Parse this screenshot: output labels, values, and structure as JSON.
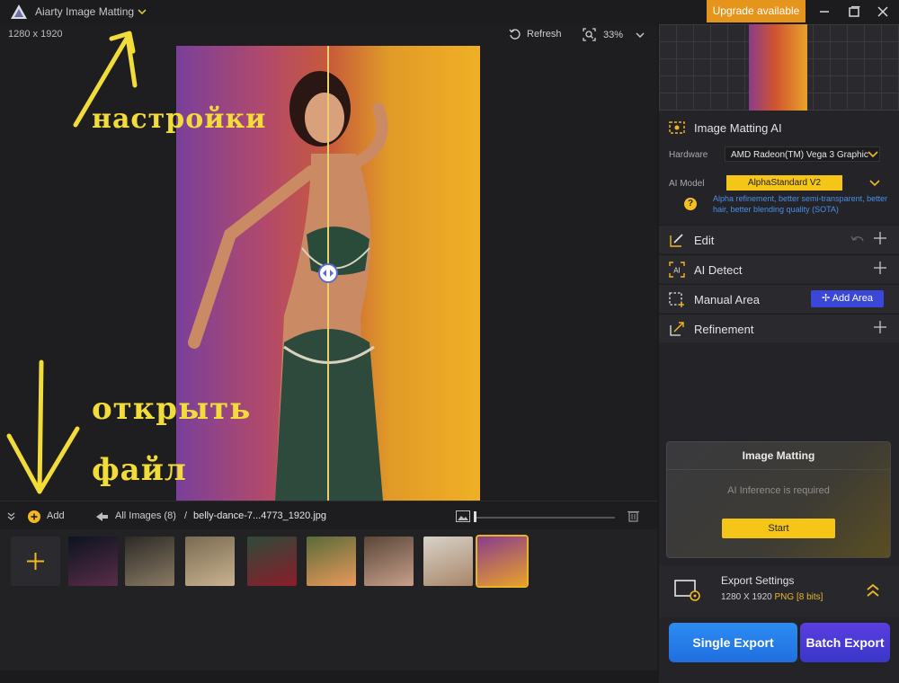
{
  "titlebar": {
    "app_title": "Aiarty Image Matting",
    "upgrade_label": "Upgrade available"
  },
  "canvas": {
    "dimensions": "1280 x 1920",
    "refresh_label": "Refresh",
    "zoom_level": "33%"
  },
  "annotations": {
    "settings_note": "настройки",
    "open_note_line1": "открыть",
    "open_note_line2": "файл"
  },
  "strip": {
    "add_label": "Add",
    "breadcrumb_all": "All Images (8)",
    "breadcrumb_sep": "/",
    "breadcrumb_file": "belly-dance-7...4773_1920.jpg",
    "thumbnails": [
      {
        "name": "jellyfish",
        "colors": [
          "#0b1420",
          "#5a2c48"
        ]
      },
      {
        "name": "forest-creature",
        "colors": [
          "#2c2a26",
          "#8a7a64"
        ]
      },
      {
        "name": "bicycle",
        "colors": [
          "#7a6a52",
          "#c8b390"
        ]
      },
      {
        "name": "woman-red-dress-forest",
        "colors": [
          "#2e4a3a",
          "#8b1d2a"
        ]
      },
      {
        "name": "woman-flowers",
        "colors": [
          "#5a6a3a",
          "#e89a5a"
        ]
      },
      {
        "name": "woman-portrait",
        "colors": [
          "#5a4638",
          "#c8a08a"
        ]
      },
      {
        "name": "woman-white-flowers",
        "colors": [
          "#d8d2c8",
          "#a8866a"
        ]
      },
      {
        "name": "belly-dancer",
        "colors": [
          "#8a3c8c",
          "#e9a22a"
        ]
      }
    ]
  },
  "side": {
    "matting_ai_title": "Image Matting AI",
    "hardware_label": "Hardware",
    "hardware_value": "AMD Radeon(TM) Vega 3 Graphic",
    "model_label": "AI Model",
    "model_value": "AlphaStandard  V2",
    "model_hint": "Alpha refinement, better semi-transparent, better hair, better blending quality  (SOTA)",
    "help_glyph": "?",
    "tools": {
      "edit": "Edit",
      "ai_detect": "AI Detect",
      "manual_area": "Manual Area",
      "add_area": "Add Area",
      "refinement": "Refinement"
    },
    "matting_card": {
      "title": "Image Matting",
      "message": "AI Inference is required",
      "start": "Start"
    },
    "export": {
      "title": "Export Settings",
      "size": "1280 X 1920",
      "format": "PNG",
      "bits": "[8 bits]"
    },
    "single_export": "Single Export",
    "batch_export": "Batch Export"
  },
  "colors": {
    "accent_yellow": "#f5c518",
    "upgrade_orange": "#e6951c",
    "add_area_blue": "#3a47d9",
    "hint_blue": "#4a8ee8"
  }
}
